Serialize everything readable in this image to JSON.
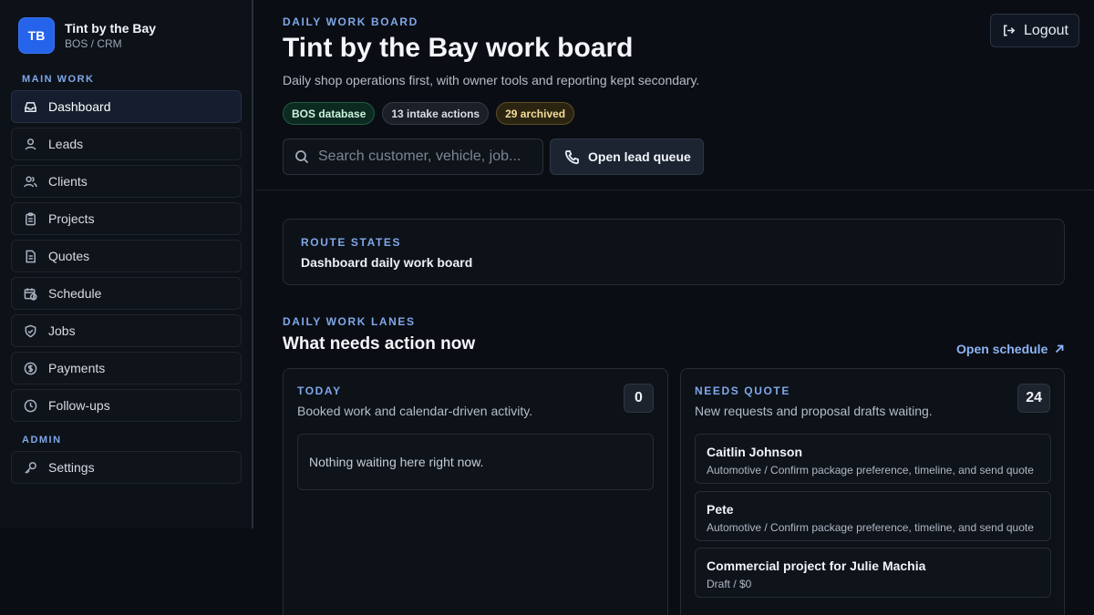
{
  "brand": {
    "initials": "TB",
    "name": "Tint by the Bay",
    "subtitle": "BOS / CRM"
  },
  "sidebar": {
    "main_label": "MAIN WORK",
    "admin_label": "ADMIN",
    "items": [
      {
        "label": "Dashboard",
        "icon": "inbox-icon",
        "active": true
      },
      {
        "label": "Leads",
        "icon": "user-icon"
      },
      {
        "label": "Clients",
        "icon": "users-icon"
      },
      {
        "label": "Projects",
        "icon": "clipboard-icon"
      },
      {
        "label": "Quotes",
        "icon": "document-icon"
      },
      {
        "label": "Schedule",
        "icon": "calendar-clock-icon"
      },
      {
        "label": "Jobs",
        "icon": "shield-icon"
      },
      {
        "label": "Payments",
        "icon": "dollar-circle-icon"
      },
      {
        "label": "Follow-ups",
        "icon": "clock-icon"
      }
    ],
    "admin_items": [
      {
        "label": "Settings",
        "icon": "key-icon"
      }
    ]
  },
  "header": {
    "eyebrow": "DAILY WORK BOARD",
    "title": "Tint by the Bay work board",
    "subtitle": "Daily shop operations first, with owner tools and reporting kept secondary.",
    "badges": [
      "BOS database",
      "13 intake actions",
      "29 archived"
    ],
    "search_placeholder": "Search customer, vehicle, job...",
    "lead_button": "Open lead queue",
    "logout": "Logout"
  },
  "route_states": {
    "label": "ROUTE STATES",
    "value": "Dashboard daily work board"
  },
  "lanes_section": {
    "eyebrow": "DAILY WORK LANES",
    "title": "What needs action now",
    "open_schedule": "Open schedule"
  },
  "lanes": {
    "today": {
      "label": "TODAY",
      "description": "Booked work and calendar-driven activity.",
      "count": "0",
      "empty": "Nothing waiting here right now."
    },
    "needs_quote": {
      "label": "NEEDS QUOTE",
      "description": "New requests and proposal drafts waiting.",
      "count": "24",
      "items": [
        {
          "name": "Caitlin Johnson",
          "detail": "Automotive / Confirm package preference, timeline, and send quote"
        },
        {
          "name": "Pete",
          "detail": "Automotive / Confirm package preference, timeline, and send quote"
        },
        {
          "name": "Commercial project for Julie Machia",
          "detail": "Draft / $0"
        }
      ]
    }
  },
  "colors": {
    "accent": "#2563eb",
    "eyebrow": "#7fa7e8",
    "link": "#8cb4f5",
    "background": "#0a0d13"
  }
}
